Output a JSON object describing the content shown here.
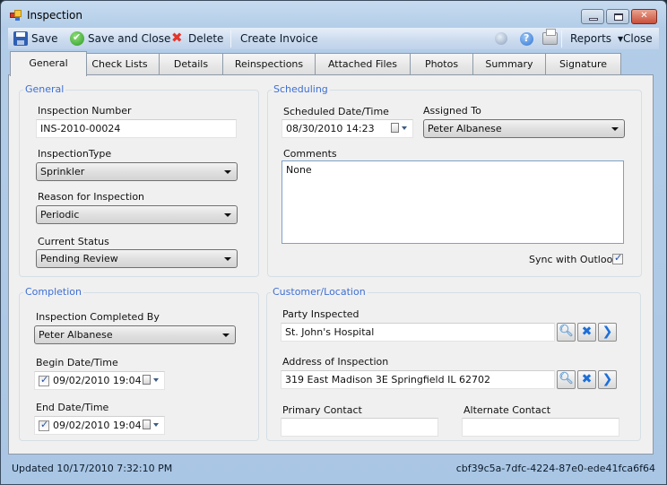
{
  "window": {
    "title": "Inspection",
    "controls": {
      "minimize": "minimize",
      "maximize": "maximize",
      "close": "close"
    }
  },
  "toolbar": {
    "save_label": "Save",
    "save_close_label": "Save and Close",
    "delete_label": "Delete",
    "create_invoice_label": "Create Invoice",
    "reports_label": "Reports",
    "close_label": "Close",
    "icons": [
      "save-icon",
      "check-icon",
      "delete-icon",
      "wizard-icon",
      "help-icon",
      "print-icon"
    ]
  },
  "tabs": [
    {
      "label": "General",
      "active": true
    },
    {
      "label": "Check Lists",
      "active": false
    },
    {
      "label": "Details",
      "active": false
    },
    {
      "label": "Reinspections",
      "active": false
    },
    {
      "label": "Attached Files",
      "active": false
    },
    {
      "label": "Photos",
      "active": false
    },
    {
      "label": "Summary",
      "active": false
    },
    {
      "label": "Signature",
      "active": false
    }
  ],
  "general": {
    "title": "General",
    "inspection_number_label": "Inspection Number",
    "inspection_number_value": "INS-2010-00024",
    "inspection_type_label": "InspectionType",
    "inspection_type_value": "Sprinkler",
    "reason_label": "Reason for Inspection",
    "reason_value": "Periodic",
    "status_label": "Current Status",
    "status_value": "Pending Review"
  },
  "scheduling": {
    "title": "Scheduling",
    "scheduled_label": "Scheduled Date/Time",
    "scheduled_value": "08/30/2010 14:23",
    "assigned_label": "Assigned To",
    "assigned_value": "Peter Albanese",
    "comments_label": "Comments",
    "comments_value": "None",
    "sync_label": "Sync with Outlook",
    "sync_checked": true
  },
  "completion": {
    "title": "Completion",
    "completed_by_label": "Inspection Completed By",
    "completed_by_value": "Peter Albanese",
    "begin_label": "Begin Date/Time",
    "begin_value": "09/02/2010 19:04",
    "begin_checked": true,
    "end_label": "End Date/Time",
    "end_value": "09/02/2010 19:04",
    "end_checked": true
  },
  "customer": {
    "title": "Customer/Location",
    "party_label": "Party Inspected",
    "party_value": "St. John's Hospital",
    "address_label": "Address of Inspection",
    "address_value": "319 East Madison 3E Springfield IL 62702",
    "primary_contact_label": "Primary Contact",
    "primary_contact_value": "",
    "alternate_contact_label": "Alternate Contact",
    "alternate_contact_value": ""
  },
  "status_bar": {
    "updated": "Updated 10/17/2010 7:32:10 PM",
    "record_id": "cbf39c5a-7dfc-4224-87e0-ede41fca6f64"
  }
}
